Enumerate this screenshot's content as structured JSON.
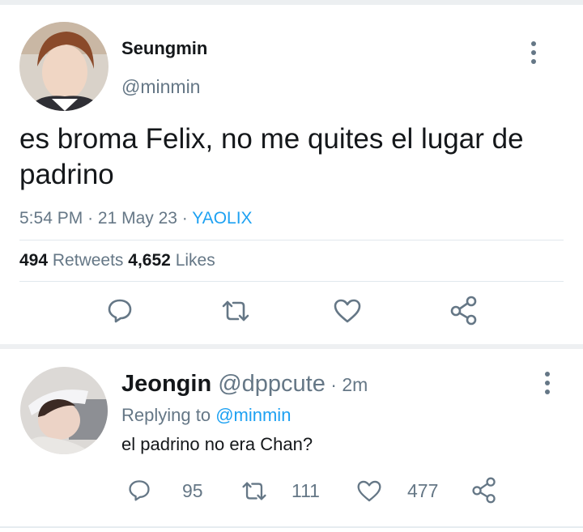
{
  "main_tweet": {
    "author_name": "Seungmin",
    "author_handle": "@minmin",
    "text": "es broma Felix, no me quites el lugar de padrino",
    "time": "5:54 PM",
    "date": "21 May 23",
    "source": "YAOLIX",
    "retweets_count": "494",
    "retweets_label": "Retweets",
    "likes_count": "4,652",
    "likes_label": "Likes",
    "actions": [
      "reply-icon",
      "retweet-icon",
      "like-icon",
      "share-icon"
    ]
  },
  "reply_tweet": {
    "author_name": "Jeongin",
    "author_handle": "@dppcute",
    "time": "2m",
    "replying_prefix": "Replying to",
    "replying_to": "@minmin",
    "text": "el padrino no era Chan?",
    "reply_count": "95",
    "retweet_count": "111",
    "like_count": "477"
  },
  "colors": {
    "accent": "#1da1f2",
    "secondary_text": "#657786",
    "primary_text": "#14171a",
    "divider": "#e1e8ed"
  }
}
